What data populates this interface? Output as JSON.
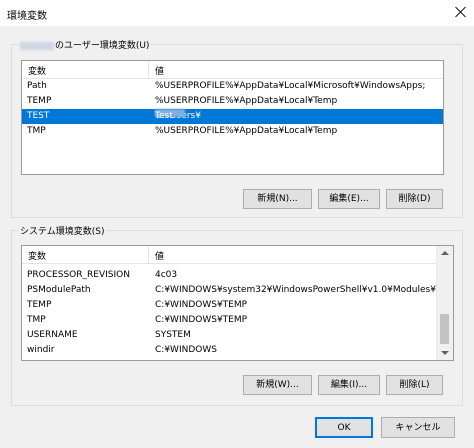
{
  "window": {
    "title": "環境変数"
  },
  "user_group": {
    "legend_suffix": "のユーザー環境変数(U)",
    "columns": [
      "変数",
      "値"
    ],
    "rows": [
      {
        "name": "Path",
        "value": "%USERPROFILE%¥AppData¥Local¥Microsoft¥WindowsApps;"
      },
      {
        "name": "TEMP",
        "value": "%USERPROFILE%¥AppData¥Local¥Temp"
      },
      {
        "name": "TEST",
        "value_prefix": "C:¥Users¥",
        "value_suffix": "Test",
        "selected": true
      },
      {
        "name": "TMP",
        "value": "%USERPROFILE%¥AppData¥Local¥Temp"
      }
    ],
    "buttons": {
      "new": "新規(N)...",
      "edit": "編集(E)...",
      "delete": "削除(D)"
    }
  },
  "system_group": {
    "legend": "システム環境変数(S)",
    "columns": [
      "変数",
      "値"
    ],
    "rows": [
      {
        "name": "PROCESSOR_REVISION",
        "value": "4c03"
      },
      {
        "name": "PSModulePath",
        "value": "C:¥WINDOWS¥system32¥WindowsPowerShell¥v1.0¥Modules¥"
      },
      {
        "name": "TEMP",
        "value": "C:¥WINDOWS¥TEMP"
      },
      {
        "name": "TMP",
        "value": "C:¥WINDOWS¥TEMP"
      },
      {
        "name": "USERNAME",
        "value": "SYSTEM"
      },
      {
        "name": "windir",
        "value": "C:¥WINDOWS"
      }
    ],
    "buttons": {
      "new": "新規(W)...",
      "edit": "編集(I)...",
      "delete": "削除(L)"
    }
  },
  "footer": {
    "ok": "OK",
    "cancel": "キャンセル"
  }
}
